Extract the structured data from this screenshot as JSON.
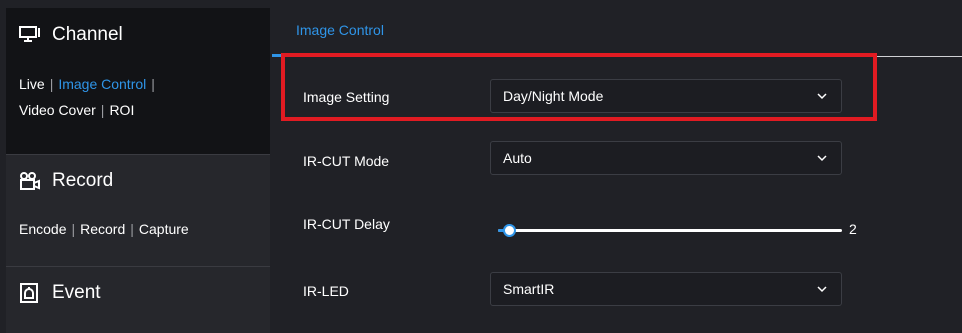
{
  "sidebar": {
    "groups": [
      {
        "title": "Channel",
        "icon": "monitor-icon",
        "links": [
          {
            "label": "Live",
            "active": false
          },
          {
            "label": "Image Control",
            "active": true
          },
          {
            "label": "Video Cover",
            "active": false
          },
          {
            "label": "ROI",
            "active": false
          }
        ]
      },
      {
        "title": "Record",
        "icon": "camera-record-icon",
        "links": [
          {
            "label": "Encode",
            "active": false
          },
          {
            "label": "Record",
            "active": false
          },
          {
            "label": "Capture",
            "active": false
          }
        ]
      },
      {
        "title": "Event",
        "icon": "event-alarm-icon",
        "links": []
      }
    ],
    "separator": "|"
  },
  "main": {
    "tab": "Image Control",
    "rows": [
      {
        "label": "Image Setting",
        "type": "select",
        "value": "Day/Night Mode"
      },
      {
        "label": "IR-CUT Mode",
        "type": "select",
        "value": "Auto"
      },
      {
        "label": "IR-CUT Delay",
        "type": "slider",
        "value": "2",
        "min": 0,
        "max": 60,
        "level": 2
      },
      {
        "label": "IR-LED",
        "type": "select",
        "value": "SmartIR"
      }
    ]
  },
  "colors": {
    "accent": "#2f95e8",
    "highlight": "#e11b22",
    "background": "#202126"
  }
}
